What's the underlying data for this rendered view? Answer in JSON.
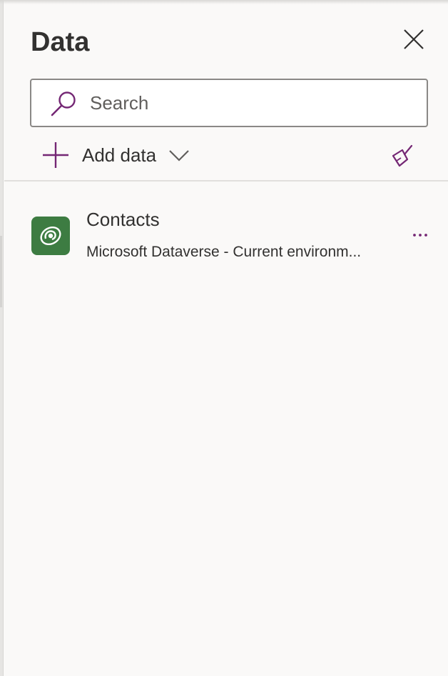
{
  "panel": {
    "title": "Data",
    "close_icon": "close-icon"
  },
  "search": {
    "placeholder": "Search",
    "value": "",
    "icon": "search-icon"
  },
  "toolbar": {
    "add_data_label": "Add data",
    "add_icon": "plus-icon",
    "dropdown_icon": "chevron-down-icon",
    "clean_icon": "broom-icon"
  },
  "data_sources": [
    {
      "name": "Contacts",
      "subtitle": "Microsoft Dataverse - Current environm...",
      "icon": "dataverse-icon",
      "more_icon": "more-options-icon"
    }
  ],
  "colors": {
    "accent": "#742774",
    "dataverse_green": "#3d7c42",
    "background": "#faf9f8",
    "text": "#323130"
  }
}
